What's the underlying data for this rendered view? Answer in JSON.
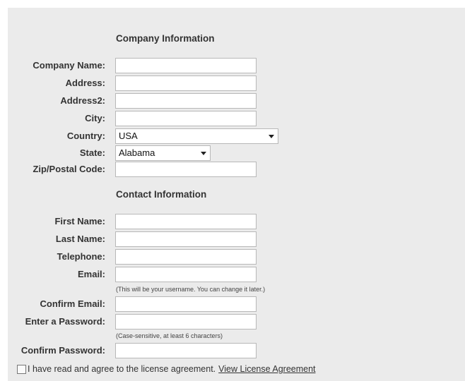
{
  "company": {
    "title": "Company Information",
    "company_name_label": "Company Name:",
    "company_name_value": "",
    "address_label": "Address:",
    "address_value": "",
    "address2_label": "Address2:",
    "address2_value": "",
    "city_label": "City:",
    "city_value": "",
    "country_label": "Country:",
    "country_value": "USA",
    "state_label": "State:",
    "state_value": "Alabama",
    "zip_label": "Zip/Postal Code:",
    "zip_value": ""
  },
  "contact": {
    "title": "Contact Information",
    "first_name_label": "First Name:",
    "last_name_label": "Last Name:",
    "telephone_label": "Telephone:",
    "email_label": "Email:",
    "email_hint": "(This will be your username. You can change it later.)",
    "confirm_email_label": "Confirm Email:",
    "password_label": "Enter a Password:",
    "password_hint": "(Case-sensitive, at least 6 characters)",
    "confirm_password_label": "Confirm Password:"
  },
  "agreement": {
    "checked": false,
    "text": "I have read and agree to the license agreement.",
    "link_text": "View License Agreement"
  }
}
